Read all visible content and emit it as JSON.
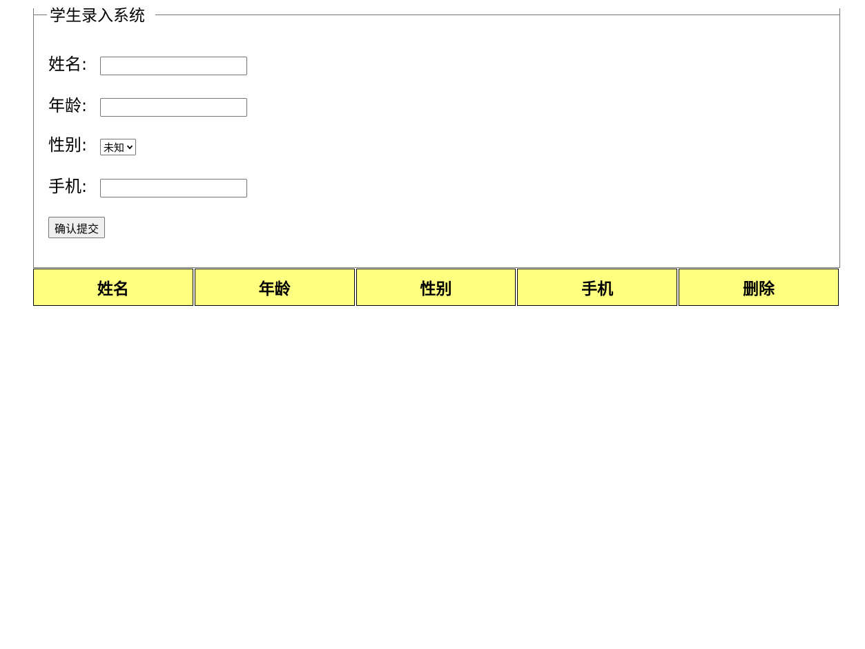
{
  "form": {
    "legend": "学生录入系统",
    "fields": {
      "name_label": "姓名:",
      "age_label": "年龄:",
      "gender_label": "性别:",
      "phone_label": "手机:"
    },
    "gender_selected": "未知",
    "submit_label": "确认提交"
  },
  "table": {
    "headers": [
      "姓名",
      "年龄",
      "性别",
      "手机",
      "删除"
    ],
    "header_bg": "#ffff80"
  }
}
